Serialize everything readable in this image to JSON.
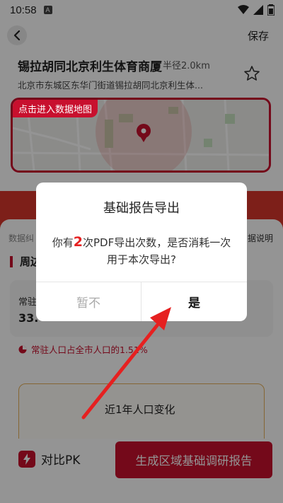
{
  "status_bar": {
    "time": "10:58",
    "badge": "A"
  },
  "header": {
    "save_label": "保存"
  },
  "place": {
    "name": "锡拉胡同北京利生体育商厦",
    "radius": "半径2.0km",
    "address": "北京市东城区东华门街道锡拉胡同北京利生体..."
  },
  "map": {
    "label": "点击进入数据地图"
  },
  "content": {
    "data_source": "数据纠",
    "data_explain": "据说明",
    "section_title": "周边",
    "stat_label": "常驻",
    "stat_value": "33.",
    "ratio_text": "常驻人口占全市人口的1.51%",
    "change_title": "近1年人口变化"
  },
  "bottom": {
    "pk_label": "对比PK",
    "generate_label": "生成区域基础调研报告"
  },
  "dialog": {
    "title": "基础报告导出",
    "msg_prefix": "你有",
    "msg_count": "2",
    "msg_suffix": "次PDF导出次数，是否消耗一次用于本次导出?",
    "cancel_label": "暂不",
    "confirm_label": "是"
  },
  "colors": {
    "brand_red": "#c8102e",
    "annotation_red": "#e62020"
  }
}
